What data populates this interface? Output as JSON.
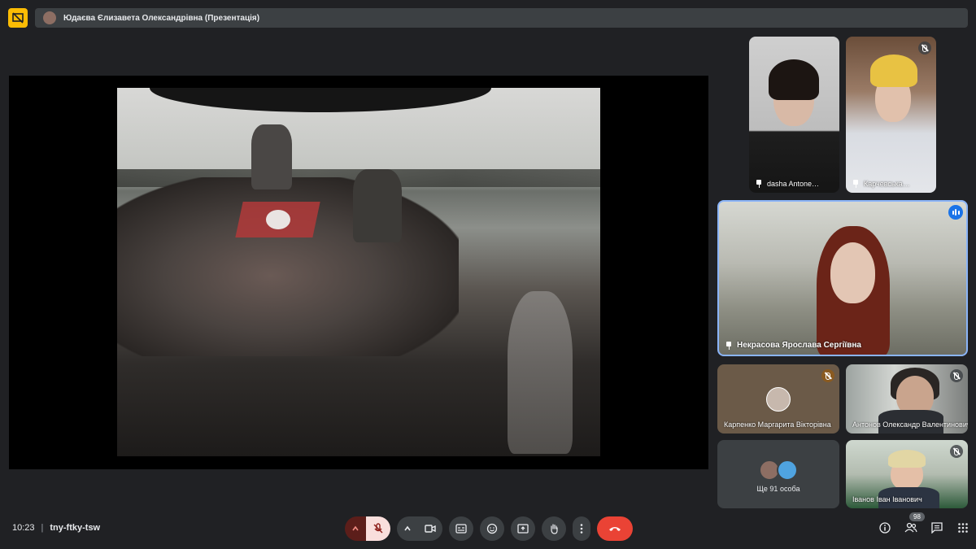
{
  "presenter_bar": {
    "title": "Юдаєва Єлизавета Олександрівна (Презентація)",
    "icon": "presentation-off-icon"
  },
  "stage": {
    "content": "shared-video"
  },
  "participants": [
    {
      "name": "dasha Antone…",
      "pinned": true
    },
    {
      "name": "Карчевська…",
      "pinned": true,
      "muted": true
    },
    {
      "name": "Некрасова Ярослава Сергіївна",
      "pinned": true,
      "speaking": true
    },
    {
      "name": "Карпенко Маргарита Вікторівна",
      "muted": true
    },
    {
      "name": "Антонов Олександр Валентинович",
      "muted": true
    },
    {
      "name": "Іванов Іван Іванович",
      "muted": true
    }
  ],
  "more_tile": {
    "label": "Ще 91 особа"
  },
  "bottom": {
    "time": "10:23",
    "separator": "|",
    "meeting_code": "tny-ftky-tsw",
    "people_count": "98"
  },
  "colors": {
    "background": "#202124",
    "accent_blue": "#8ab4f8",
    "hangup_red": "#ea4335",
    "presenter_yellow": "#fbbc04"
  }
}
